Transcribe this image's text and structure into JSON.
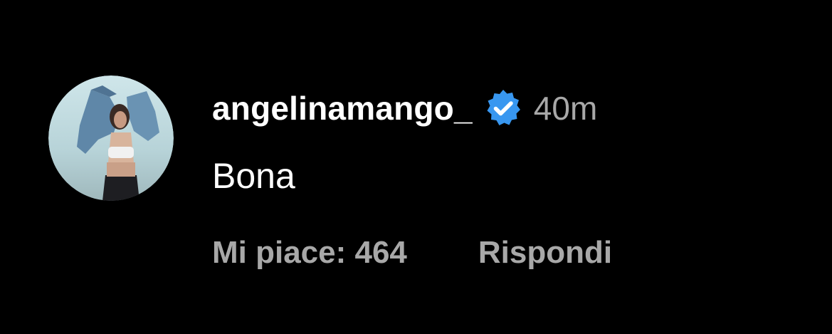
{
  "comment": {
    "username": "angelinamango_",
    "verified": true,
    "timestamp": "40m",
    "text": "Bona",
    "likes_label": "Mi piace: 464",
    "reply_label": "Rispondi"
  },
  "icons": {
    "avatar": "profile-photo",
    "badge": "verified-badge-icon"
  },
  "colors": {
    "background": "#000000",
    "primary_text": "#ffffff",
    "secondary_text": "#a8a8a8",
    "verified_blue": "#3897f0"
  }
}
